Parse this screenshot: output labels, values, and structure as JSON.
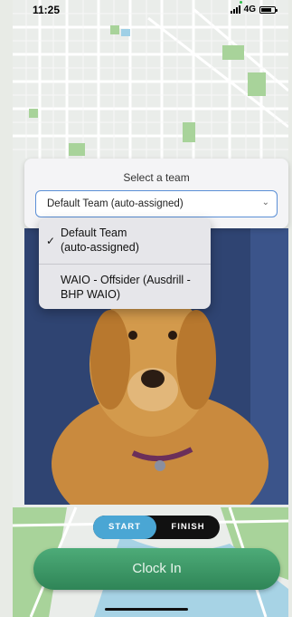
{
  "status_bar": {
    "time": "11:25",
    "network": "4G"
  },
  "team_select": {
    "title": "Select a team",
    "selected_value": "Default Team (auto-assigned)",
    "options": [
      {
        "label": "Default Team (auto-assigned)",
        "selected": true
      },
      {
        "label": "WAIO - Offsider (Ausdrill - BHP WAIO)",
        "selected": false
      }
    ]
  },
  "option_lines": {
    "opt1_line1": "Default Team",
    "opt1_line2": "(auto-assigned)",
    "opt2_line1": "WAIO - Offsider (Ausdrill -",
    "opt2_line2": "BHP WAIO)"
  },
  "mode_toggle": {
    "start_label": "START",
    "finish_label": "FINISH",
    "active": "START"
  },
  "clock_in": {
    "label": "Clock In"
  },
  "colors": {
    "accent_blue": "#4aa6d4",
    "clock_in_green": "#3a9a66",
    "select_border": "#5b8fd6"
  },
  "icons": {
    "check": "checkmark-icon",
    "chevron": "chevron-down-icon"
  }
}
